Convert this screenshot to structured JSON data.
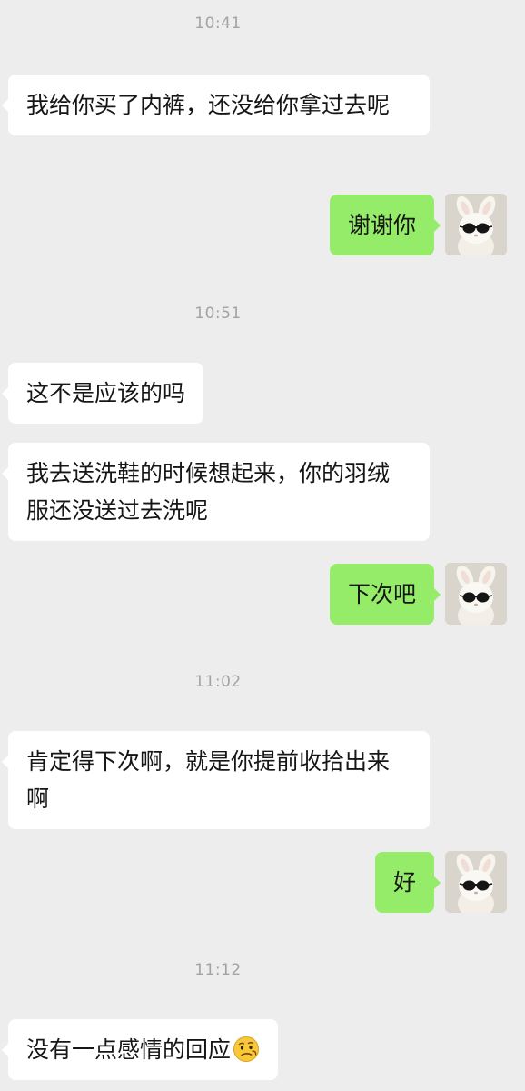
{
  "chat": {
    "timestamps": [
      "10:41",
      "10:51",
      "11:02",
      "11:12"
    ],
    "messages": [
      {
        "sender": "other",
        "text": "我给你买了内裤，还没给你拿过去呢"
      },
      {
        "sender": "me",
        "text": "谢谢你"
      },
      {
        "sender": "other",
        "text": "这不是应该的吗"
      },
      {
        "sender": "other",
        "text": "我去送洗鞋的时候想起来，你的羽绒服还没送过去洗呢"
      },
      {
        "sender": "me",
        "text": "下次吧"
      },
      {
        "sender": "other",
        "text": "肯定得下次啊，就是你提前收拾出来啊"
      },
      {
        "sender": "me",
        "text": "好"
      },
      {
        "sender": "other",
        "text": "没有一点感情的回应",
        "emoji": "confused-face-icon"
      }
    ]
  },
  "colors": {
    "background": "#ededed",
    "incoming_bubble": "#ffffff",
    "outgoing_bubble": "#95ec69",
    "timestamp_text": "#a3a3a3",
    "message_text": "#161616"
  },
  "avatar": {
    "icon": "bunny-with-sunglasses-icon"
  }
}
